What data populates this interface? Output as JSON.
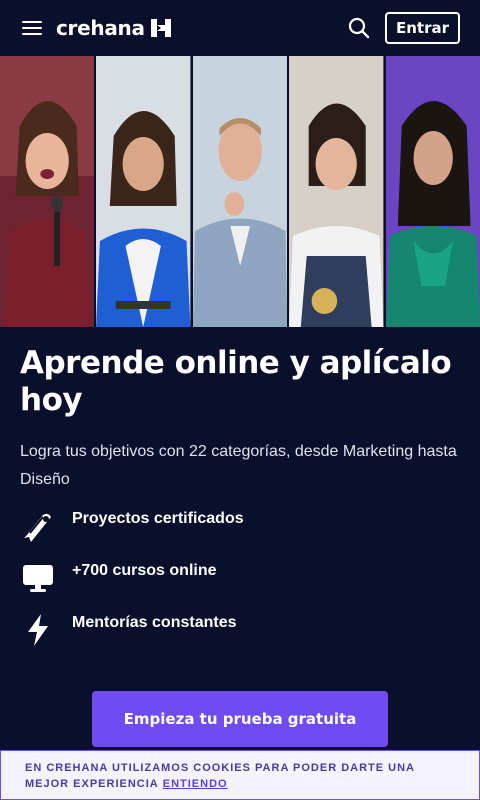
{
  "header": {
    "menu_icon": "hamburger-menu-icon",
    "logo_text": "crehana",
    "logo_icon": "crehana-mark-icon",
    "search_icon": "search-icon",
    "login_label": "Entrar"
  },
  "hero": {
    "panels": [
      {
        "subject": "woman-with-microphone",
        "bg": "#8b2f3a"
      },
      {
        "subject": "woman-blue-blazer",
        "bg": "#2d6bd8"
      },
      {
        "subject": "man-grey-suit",
        "bg": "#9db4c9"
      },
      {
        "subject": "woman-apron",
        "bg": "#c9c2b6"
      },
      {
        "subject": "woman-green-blouse",
        "bg": "#7b54d8"
      }
    ]
  },
  "main": {
    "title": "Aprende online y aplícalo hoy",
    "subtitle": "Logra tus objetivos con 22 categorías, desde Marketing hasta Diseño",
    "features": [
      {
        "icon": "certificate-icon",
        "label": "Proyectos certificados"
      },
      {
        "icon": "monitor-icon",
        "label": "+700 cursos online"
      },
      {
        "icon": "lightning-icon",
        "label": "Mentorías constantes"
      }
    ],
    "cta_label": "Empieza tu prueba gratuita"
  },
  "cookie_bar": {
    "text": "EN CREHANA UTILIZAMOS COOKIES PARA PODER DARTE UNA MEJOR EXPERIENCIA",
    "link_label": "ENTIENDO"
  },
  "colors": {
    "background": "#0a0f2c",
    "accent": "#6e4bf5",
    "cookie_bg": "#f5f3fd"
  }
}
